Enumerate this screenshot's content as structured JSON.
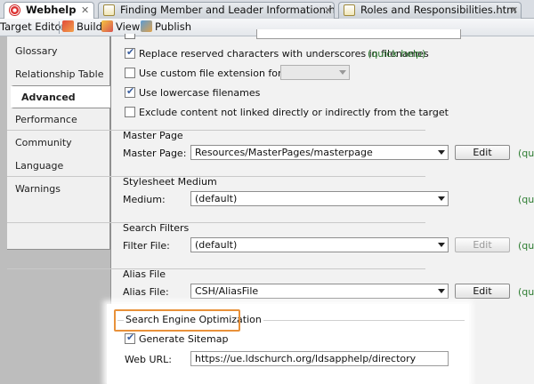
{
  "tabs": [
    {
      "label": "Webhelp",
      "icon": "webhelp-target-icon",
      "active": true
    },
    {
      "label": "Finding Member and Leader Information.htm",
      "icon": "topic-icon",
      "active": false
    },
    {
      "label": "Roles and Responsibilities.htm",
      "icon": "topic-icon",
      "active": false
    }
  ],
  "toolbar": {
    "editor_label": "Target Editor",
    "build_label": "Build",
    "view_label": "View",
    "publish_label": "Publish"
  },
  "nav": {
    "items": [
      "Glossary",
      "Relationship Table",
      "Advanced",
      "Performance",
      "Community",
      "Language",
      "Warnings"
    ],
    "active": "Advanced"
  },
  "options": {
    "replace_label": "Replace reserved characters with underscores in filenames",
    "custom_ext_label": "Use custom file extension for topics",
    "lowercase_label": "Use lowercase filenames",
    "exclude_label": "Exclude content not linked directly or indirectly from the target",
    "quick_help": "(quick help)",
    "quick_help_cut": "(quic"
  },
  "master_page": {
    "title": "Master Page",
    "label": "Master Page:",
    "value": "Resources/MasterPages/masterpage",
    "edit": "Edit"
  },
  "stylesheet": {
    "title": "Stylesheet Medium",
    "label": "Medium:",
    "value": "(default)"
  },
  "search_filters": {
    "title": "Search Filters",
    "label": "Filter File:",
    "value": "(default)",
    "edit": "Edit"
  },
  "alias": {
    "title": "Alias File",
    "label": "Alias File:",
    "value": "CSH/AliasFile",
    "edit": "Edit"
  },
  "seo": {
    "title": "Search Engine Optimization",
    "sitemap_label": "Generate Sitemap",
    "url_label": "Web URL:",
    "url_value": "https://ue.ldschurch.org/ldsapphelp/directory"
  },
  "colors": {
    "highlight_border": "#e8913a",
    "quick_help": "#2e7d32"
  }
}
